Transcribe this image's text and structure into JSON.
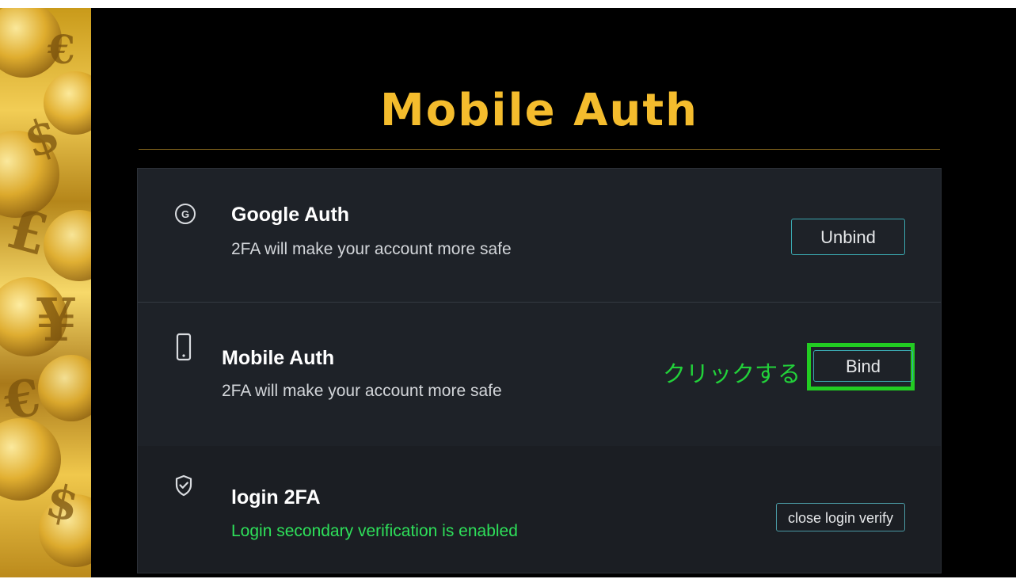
{
  "title": "Mobile Auth",
  "rows": [
    {
      "icon": "google-circle-icon",
      "icon_glyph": "G",
      "title": "Google Auth",
      "description": "2FA will make your account more safe",
      "button_label": "Unbind"
    },
    {
      "icon": "phone-icon",
      "title": "Mobile Auth",
      "description": "2FA will make your account more safe",
      "button_label": "Bind",
      "annotation": "クリックする"
    },
    {
      "icon": "shield-check-icon",
      "title": "login 2FA",
      "description": "Login secondary verification is enabled",
      "button_label": "close login verify"
    }
  ],
  "colors": {
    "title": "#f4bc2d",
    "panel_bg": "#1e2228",
    "button_border": "#3aa8b0",
    "highlight": "#22cc22",
    "status_green": "#2ee05a"
  }
}
